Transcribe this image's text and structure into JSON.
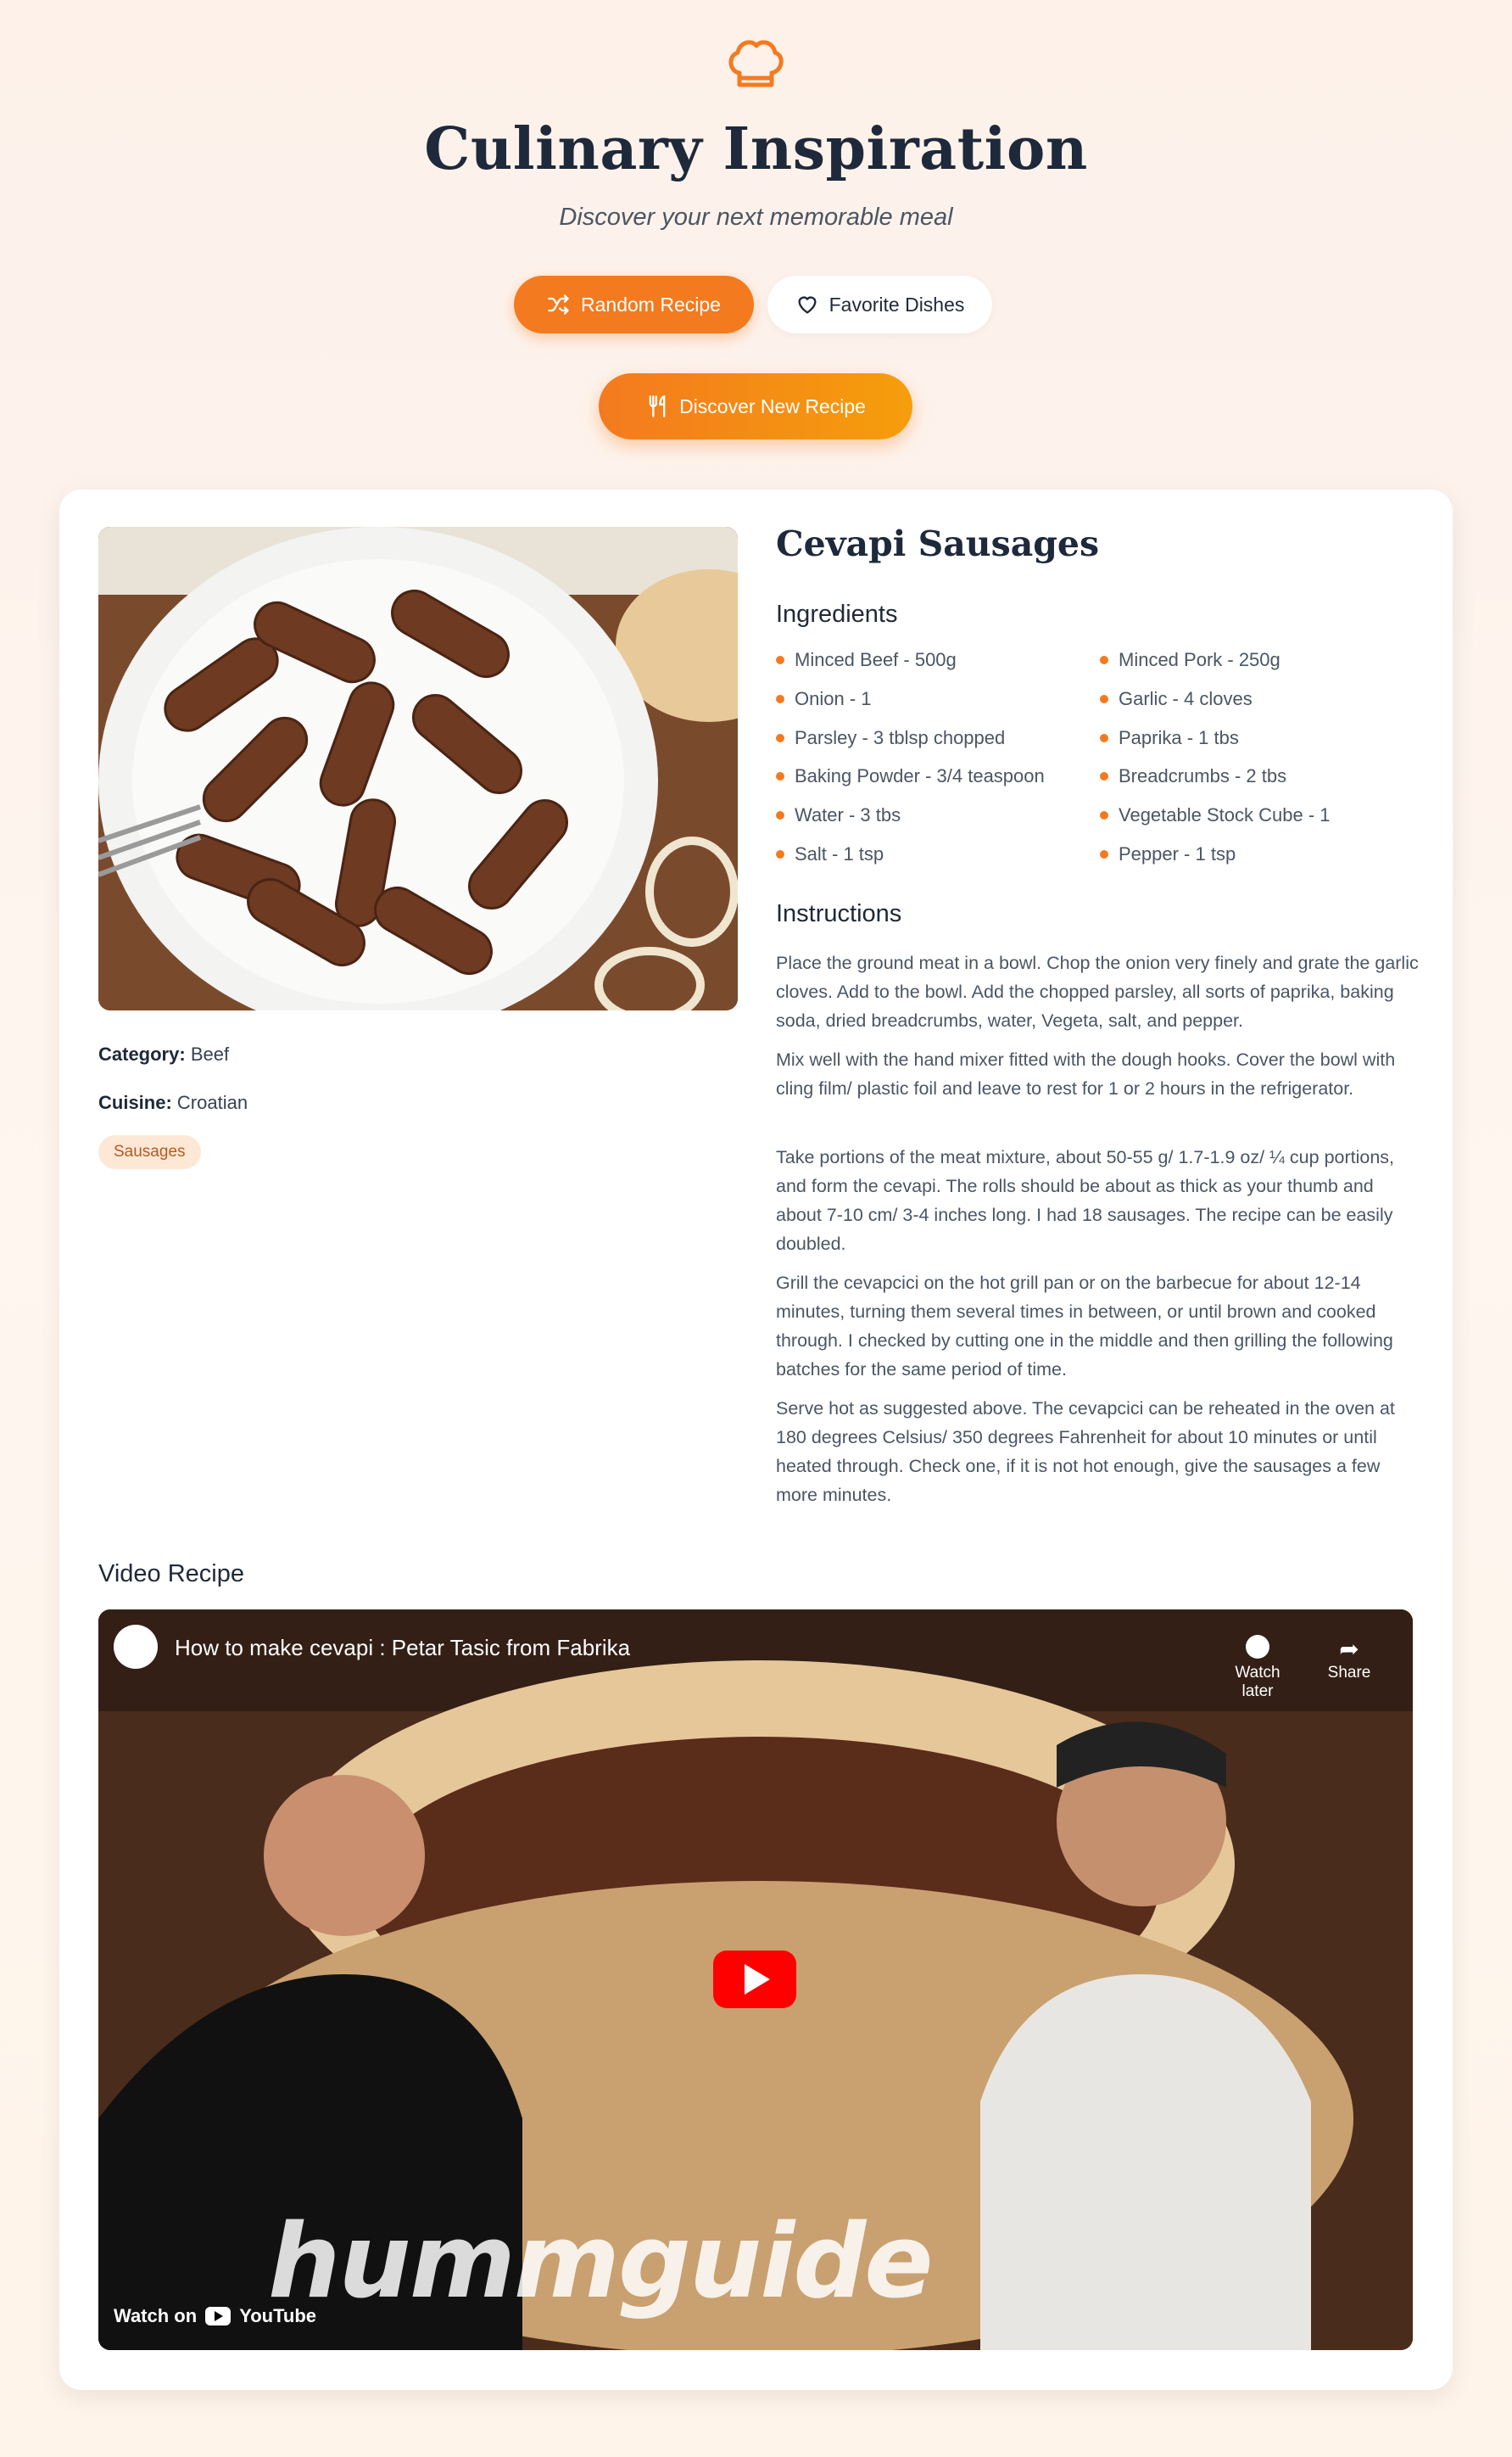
{
  "header": {
    "title": "Culinary Inspiration",
    "subtitle": "Discover your next memorable meal",
    "random_label": "Random Recipe",
    "favorite_label": "Favorite Dishes",
    "discover_label": "Discover New Recipe"
  },
  "recipe": {
    "name": "Cevapi Sausages",
    "category_label": "Category:",
    "category": "Beef",
    "cuisine_label": "Cuisine:",
    "cuisine": "Croatian",
    "tag": "Sausages",
    "ingredients_heading": "Ingredients",
    "ingredients": [
      "Minced Beef - 500g",
      "Minced Pork - 250g",
      "Onion - 1",
      "Garlic - 4 cloves",
      "Parsley - 3 tblsp chopped",
      "Paprika - 1 tbs",
      "Baking Powder - 3/4 teaspoon",
      "Breadcrumbs - 2 tbs",
      "Water - 3 tbs",
      "Vegetable Stock Cube - 1",
      "Salt - 1 tsp",
      "Pepper - 1 tsp"
    ],
    "instructions_heading": "Instructions",
    "instructions": [
      "Place the ground meat in a bowl. Chop the onion very finely and grate the garlic cloves. Add to the bowl. Add the chopped parsley, all sorts of paprika, baking soda, dried breadcrumbs, water, Vegeta, salt, and pepper.",
      "Mix well with the hand mixer fitted with the dough hooks. Cover the bowl with cling film/ plastic foil and leave to rest for 1 or 2 hours in the refrigerator.",
      "Take portions of the meat mixture, about 50-55 g/ 1.7-1.9 oz/ ¼ cup portions, and form the cevapi. The rolls should be about as thick as your thumb and about 7-10 cm/ 3-4 inches long. I had 18 sausages. The recipe can be easily doubled.",
      "Grill the cevapcici on the hot grill pan or on the barbecue for about 12-14 minutes, turning them several times in between, or until brown and cooked through. I checked by cutting one in the middle and then grilling the following batches for the same period of time.",
      "Serve hot as suggested above. The cevapcici can be reheated in the oven at 180 degrees Celsius/ 350 degrees Fahrenheit for about 10 minutes or until heated through. Check one, if it is not hot enough, give the sausages a few more minutes."
    ],
    "video_heading": "Video Recipe",
    "video": {
      "title": "How to make cevapi : Petar Tasic from Fabrika",
      "watch_later": "Watch later",
      "share": "Share",
      "watch_on": "Watch on",
      "youtube": "YouTube",
      "watermark": "hummguide"
    }
  },
  "colors": {
    "accent": "#f47a1f",
    "accent2": "#f59e0b",
    "heading": "#1e293b"
  }
}
